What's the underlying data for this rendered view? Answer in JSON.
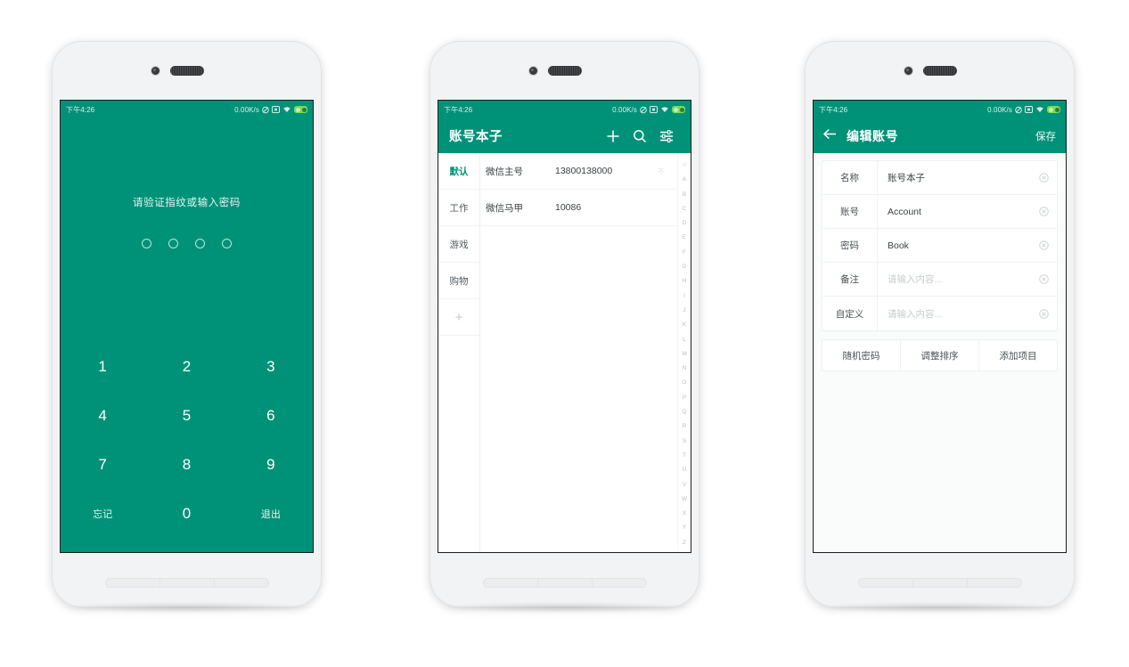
{
  "theme": {
    "accent": "#009279",
    "screen_bg": "#ffffff",
    "text": "#3b4043",
    "placeholder": "#c8cdd0"
  },
  "status_bar": {
    "time": "下午4:26",
    "net_speed": "0.00K/s",
    "icons": [
      "vibrate-icon",
      "sim-card-icon",
      "wifi-icon",
      "battery-icon"
    ]
  },
  "phone1": {
    "name": "lock-screen",
    "hint": "请验证指纹或输入密码",
    "pin_dots": 4,
    "keys": [
      {
        "label": "1",
        "kind": "digit"
      },
      {
        "label": "2",
        "kind": "digit"
      },
      {
        "label": "3",
        "kind": "digit"
      },
      {
        "label": "4",
        "kind": "digit"
      },
      {
        "label": "5",
        "kind": "digit"
      },
      {
        "label": "6",
        "kind": "digit"
      },
      {
        "label": "7",
        "kind": "digit"
      },
      {
        "label": "8",
        "kind": "digit"
      },
      {
        "label": "9",
        "kind": "digit"
      },
      {
        "label": "忘记",
        "kind": "action"
      },
      {
        "label": "0",
        "kind": "digit"
      },
      {
        "label": "退出",
        "kind": "action"
      }
    ]
  },
  "phone2": {
    "name": "account-list",
    "appbar": {
      "title": "账号本子",
      "actions": [
        "add-icon",
        "search-icon",
        "filter-icon"
      ]
    },
    "categories": [
      {
        "label": "默认",
        "active": true
      },
      {
        "label": "工作",
        "active": false
      },
      {
        "label": "游戏",
        "active": false
      },
      {
        "label": "购物",
        "active": false
      },
      {
        "label": "+",
        "active": false,
        "is_add": true
      }
    ],
    "items": [
      {
        "name": "微信主号",
        "value": "13800138000",
        "mark": "不"
      },
      {
        "name": "微信马甲",
        "value": "10086",
        "mark": ""
      }
    ],
    "alpha_index": [
      "☆",
      "A",
      "B",
      "C",
      "D",
      "E",
      "F",
      "G",
      "H",
      "I",
      "J",
      "K",
      "L",
      "M",
      "N",
      "O",
      "P",
      "Q",
      "R",
      "S",
      "T",
      "U",
      "V",
      "W",
      "X",
      "Y",
      "Z",
      "#"
    ]
  },
  "phone3": {
    "name": "edit-account",
    "appbar": {
      "back": "back-arrow-icon",
      "title": "编辑账号",
      "save_label": "保存"
    },
    "fields": [
      {
        "label": "名称",
        "value": "账号本子",
        "placeholder": "请输入内容...",
        "empty": false
      },
      {
        "label": "账号",
        "value": "Account",
        "placeholder": "请输入内容...",
        "empty": false
      },
      {
        "label": "密码",
        "value": "Book",
        "placeholder": "请输入内容...",
        "empty": false
      },
      {
        "label": "备注",
        "value": "",
        "placeholder": "请输入内容...",
        "empty": true
      },
      {
        "label": "自定义",
        "value": "",
        "placeholder": "请输入内容...",
        "empty": true
      }
    ],
    "buttons": [
      {
        "label": "随机密码"
      },
      {
        "label": "调整排序"
      },
      {
        "label": "添加项目"
      }
    ]
  }
}
